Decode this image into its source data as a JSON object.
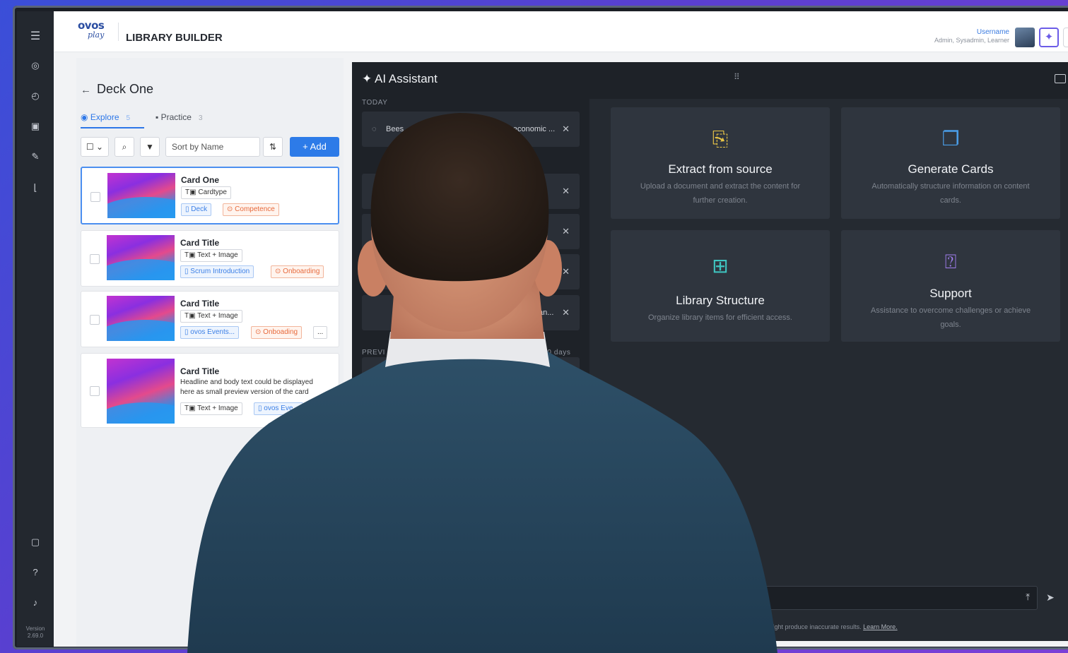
{
  "app": {
    "logo_line1": "ovos",
    "logo_line2": "play",
    "title": "LIBRARY BUILDER",
    "user_name": "Username",
    "user_roles": "Admin, Sysadmin, Learner",
    "version_label": "Version",
    "version_number": "2.69.0"
  },
  "rail_icons": [
    "menu-icon",
    "target-icon",
    "clock-icon",
    "chat-icon",
    "pin-icon",
    "chart-icon",
    "document-icon",
    "help-icon",
    "bell-icon"
  ],
  "library": {
    "deck_title": "Deck One",
    "tabs": [
      {
        "label": "Explore",
        "count": "5"
      },
      {
        "label": "Practice",
        "count": "3"
      }
    ],
    "sort_label": "Sort by Name",
    "add_label": "Add",
    "cards": [
      {
        "title": "Card One",
        "body": "",
        "type": "Cardtype",
        "tag_blue": "Deck",
        "tag_orange": "Competence",
        "more": ""
      },
      {
        "title": "Card Title",
        "body": "",
        "type": "Text + Image",
        "tag_blue": "Scrum Introduction",
        "tag_orange": "Onboarding",
        "more": ""
      },
      {
        "title": "Card Title",
        "body": "",
        "type": "Text + Image",
        "tag_blue": "ovos Events...",
        "tag_orange": "Onboading",
        "more": "..."
      },
      {
        "title": "Card Title",
        "body": "Headline and body text could be displayed here as small preview version of the card",
        "type": "Text + Image",
        "tag_blue": "ovos Eve...",
        "tag_orange": "",
        "more": "..."
      }
    ]
  },
  "assistant": {
    "title": "AI Assistant",
    "history_today": "TODAY",
    "history_prev": "PREVI",
    "history_retention": "fter 30 days",
    "history_items": [
      {
        "text": "Bees",
        "text_right": "ty, economic ..."
      },
      {
        "text": "",
        "text_right": ""
      },
      {
        "text": "",
        "text_right": ""
      },
      {
        "text": "",
        "text_right": ""
      },
      {
        "text": "",
        "text_right": "an..."
      },
      {
        "text": "",
        "text_right": ""
      }
    ],
    "features": [
      {
        "title": "Extract from source",
        "desc": "Upload a document and extract the content for further creation.",
        "icon": "document-import-icon",
        "color": "#e8c547"
      },
      {
        "title": "Generate Cards",
        "desc": "Automatically structure information on content cards.",
        "icon": "copy-cards-icon",
        "color": "#4a9ee8"
      },
      {
        "title": "Library Structure",
        "desc": "Organize library items for efficient access.",
        "icon": "tree-structure-icon",
        "color": "#3fc6c1"
      },
      {
        "title": "Support",
        "desc": "Assistance to overcome challenges or achieve goals.",
        "icon": "question-box-icon",
        "color": "#a27ef0"
      }
    ],
    "disclaimer": "nt might produce inaccurate results.",
    "learn_more": "Learn More."
  }
}
